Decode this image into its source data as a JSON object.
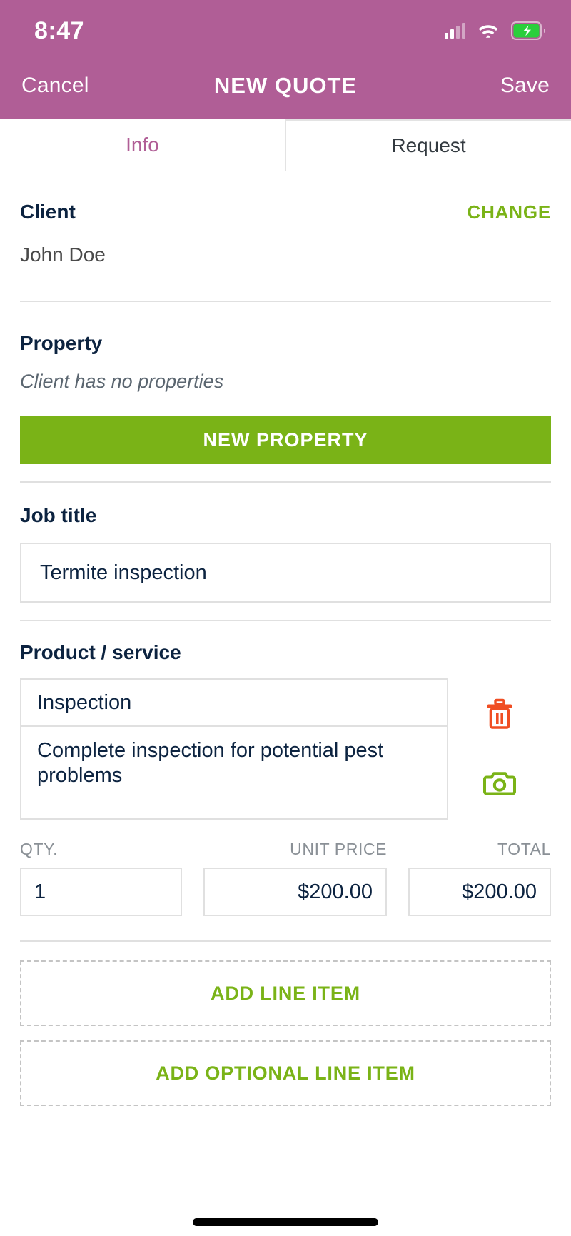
{
  "status_bar": {
    "time": "8:47",
    "cellular_icon": "cellular-signal-icon",
    "wifi_icon": "wifi-icon",
    "battery_icon": "battery-charging-icon"
  },
  "header": {
    "cancel_label": "Cancel",
    "title": "NEW QUOTE",
    "save_label": "Save",
    "background_color": "#B05E96"
  },
  "tabs": [
    {
      "label": "Info",
      "active": true
    },
    {
      "label": "Request",
      "active": false
    }
  ],
  "client": {
    "section_label": "Client",
    "change_label": "CHANGE",
    "name": "John Doe"
  },
  "property": {
    "section_label": "Property",
    "empty_note": "Client has no properties",
    "new_property_label": "NEW PROPERTY"
  },
  "job_title": {
    "section_label": "Job title",
    "value": "Termite inspection"
  },
  "product_service": {
    "section_label": "Product / service",
    "name": "Inspection",
    "description": "Complete inspection for potential pest problems",
    "delete_icon": "trash-icon",
    "camera_icon": "camera-icon",
    "qty_header": "QTY.",
    "unit_price_header": "UNIT PRICE",
    "total_header": "TOTAL",
    "qty_value": "1",
    "unit_price_value": "$200.00",
    "total_value": "$200.00"
  },
  "actions": {
    "add_line_item_label": "ADD LINE ITEM",
    "add_optional_line_item_label": "ADD OPTIONAL LINE ITEM"
  },
  "colors": {
    "brand_purple": "#B05E96",
    "accent_green": "#7AB317",
    "delete_red": "#F04E23",
    "navy_text": "#0c2340"
  }
}
